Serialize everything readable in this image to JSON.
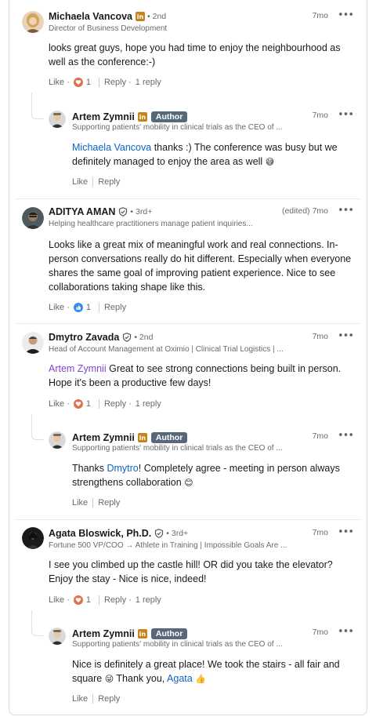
{
  "comments": [
    {
      "name": "Michaela Vancova",
      "degree": "• 2nd",
      "headline": "Director of Business Development",
      "time": "7mo",
      "text": "looks great guys, hope you had time to enjoy the neighbourhood as well as the conference:-)",
      "like_label": "Like",
      "reaction_count": "1",
      "reply_label": "Reply",
      "replies_label": "1 reply",
      "reply": {
        "name": "Artem Zymnii",
        "badge": "Author",
        "headline": "Supporting patients' mobility in clinical trials as the CEO of ...",
        "time": "7mo",
        "mention": "Michaela Vancova",
        "text": " thanks :) The conference was busy but we definitely managed to enjoy the area as well ",
        "emoji": "😅",
        "like_label": "Like",
        "reply_label": "Reply"
      }
    },
    {
      "name": "ADITYA AMAN",
      "degree": "• 3rd+",
      "headline": "Helping healthcare practitioners manage patient inquiries...",
      "edited": "(edited)",
      "time": "7mo",
      "text": "Looks like a great mix of meaningful work and real connections. In-person conversations really do hit different. Especially when everyone shares the same goal of improving patient experience. Nice to see collaborations taking shape like this.",
      "like_label": "Like",
      "reaction_count": "1",
      "reply_label": "Reply"
    },
    {
      "name": "Dmytro Zavada",
      "degree": "• 2nd",
      "headline": "Head of Account Management at Oximio | Clinical Trial Logistics | ...",
      "time": "7mo",
      "mention": "Artem Zymnii",
      "text": " Great to see strong connections being built in person.  Hope it's been a productive few days!",
      "like_label": "Like",
      "reaction_count": "1",
      "reply_label": "Reply",
      "replies_label": "1 reply",
      "reply": {
        "name": "Artem Zymnii",
        "badge": "Author",
        "headline": "Supporting patients' mobility in clinical trials as the CEO of ...",
        "time": "7mo",
        "text_before": "Thanks ",
        "mention": "Dmytro",
        "text": "! Completely agree - meeting in person always strengthens collaboration ",
        "emoji": "😊",
        "like_label": "Like",
        "reply_label": "Reply"
      }
    },
    {
      "name": "Agata Bloswick, Ph.D.",
      "degree": "• 3rd+",
      "headline": "Fortune 500 VP/COO → Athlete in Training | Impossible Goals Are ...",
      "time": "7mo",
      "text": "I see you climbed up the castle hill! OR did you take the elevator? Enjoy the stay - Nice is nice, indeed!",
      "like_label": "Like",
      "reaction_count": "1",
      "reply_label": "Reply",
      "replies_label": "1 reply",
      "reply": {
        "name": "Artem Zymnii",
        "badge": "Author",
        "headline": "Supporting patients' mobility in clinical trials as the CEO of ...",
        "time": "7mo",
        "text": "Nice is definitely a great place! We took the stairs - all fair and square ",
        "emoji": "😜",
        "text_after": " Thank you, ",
        "mention": "Agata",
        "emoji2": "👍",
        "like_label": "Like",
        "reply_label": "Reply"
      }
    }
  ],
  "icons": {
    "linkedin_badge": "in",
    "more": "•••",
    "heart_reaction_color": "#df704d",
    "like_reaction_color": "#378fe9"
  }
}
